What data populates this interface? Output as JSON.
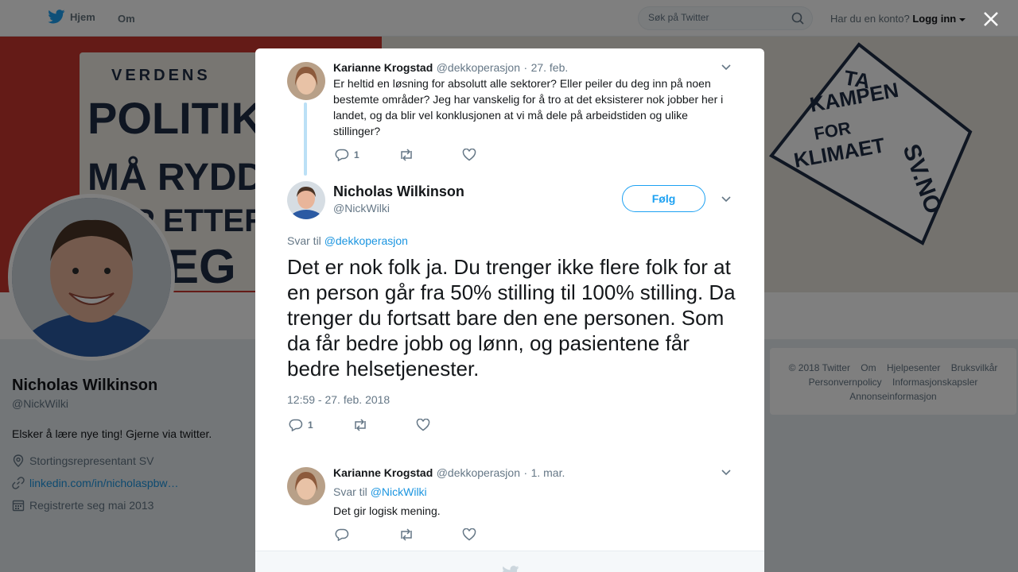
{
  "nav": {
    "home_label": "Hjem",
    "about_label": "Om",
    "search_placeholder": "Søk på Twitter",
    "login_question": "Har du en konto?",
    "login_label": "Logg inn"
  },
  "banner": {
    "left_lines": [
      "VERDENS",
      "POLITIKERE",
      "MÅ RYDDE",
      "OPP ETTER",
      "EG"
    ],
    "right_lines": [
      "TA",
      "KAMPEN",
      "FOR",
      "KLIMAET",
      "SV.NO"
    ]
  },
  "profile": {
    "name": "Nicholas Wilkinson",
    "handle": "@NickWilki",
    "bio": "Elsker å lære nye ting! Gjerne via twitter.",
    "location": "Stortingsrepresentant SV",
    "url": "linkedin.com/in/nicholaspbw…",
    "joined": "Registrerte seg mai 2013"
  },
  "footer": {
    "links": [
      "© 2018 Twitter",
      "Om",
      "Hjelpesenter",
      "Bruksvilkår",
      "Personvernpolicy",
      "Informasjonskapsler",
      "Annonseinformasjon"
    ]
  },
  "modal": {
    "parent": {
      "name": "Karianne Krogstad",
      "handle": "@dekkoperasjon",
      "date": "27. feb.",
      "separator": "·",
      "text": "Er heltid en løsning for absolutt alle sektorer? Eller peiler du deg inn på noen bestemte områder? Jeg har vanskelig for å tro at det eksisterer nok jobber her i landet, og da blir vel konklusjonen at vi må dele på arbeidstiden og ulike stillinger?",
      "reply_count": "1"
    },
    "main": {
      "name": "Nicholas Wilkinson",
      "handle": "@NickWilki",
      "follow_label": "Følg",
      "reply_prefix": "Svar til",
      "reply_to": "@dekkoperasjon",
      "text": "Det er nok folk ja. Du trenger ikke flere folk for at en person går fra 50% stilling til 100% stilling. Da trenger du fortsatt bare den ene personen. Som da får bedre jobb og lønn, og pasientene får bedre helsetjenester.",
      "timestamp": "12:59 - 27. feb. 2018",
      "reply_count": "1"
    },
    "reply": {
      "name": "Karianne Krogstad",
      "handle": "@dekkoperasjon",
      "date": "1. mar.",
      "separator": "·",
      "reply_prefix": "Svar til",
      "reply_to": "@NickWilki",
      "text": "Det gir logisk mening."
    }
  },
  "colors": {
    "accent": "#1da1f2",
    "link": "#1b95e0",
    "muted": "#657786",
    "thread": "#bbe0f6"
  }
}
